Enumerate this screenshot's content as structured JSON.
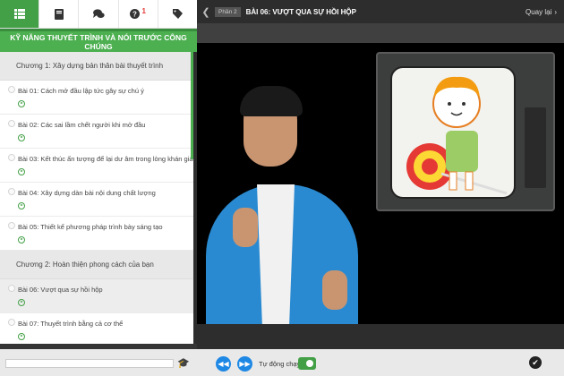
{
  "tabs": [
    {
      "icon": "list-icon",
      "active": true
    },
    {
      "icon": "book-icon",
      "active": false
    },
    {
      "icon": "chat-icon",
      "active": false
    },
    {
      "icon": "question-icon",
      "badge": "1",
      "active": false
    },
    {
      "icon": "tag-icon",
      "active": false
    }
  ],
  "course": {
    "title": "KỸ NĂNG THUYẾT TRÌNH VÀ NÓI TRƯỚC CÔNG CHÚNG"
  },
  "chapters": [
    {
      "title": "Chương 1: Xây dựng bản thân bài thuyết trình",
      "lessons": [
        "Bài 01: Cách mở đầu lập tức gây sự chú ý",
        "Bài 02: Các sai lầm chết người khi mở đầu",
        "Bài 03: Kết thúc ấn tượng để lại dư âm trong lòng khán giả",
        "Bài 04: Xây dựng dàn bài nội dung chất lượng",
        "Bài 05: Thiết kế phương pháp trình bày sáng tạo"
      ]
    },
    {
      "title": "Chương 2: Hoàn thiện phong cách của bạn",
      "lessons": [
        "Bài 06: Vượt qua sự hồi hộp",
        "Bài 07: Thuyết trình bằng cả cơ thể"
      ]
    }
  ],
  "header": {
    "part": "Phần 2",
    "lesson_title": "BÀI 06: VƯỢT QUA SỰ HỒI HỘP",
    "back_label": "Quay lại"
  },
  "player": {
    "autoplay_label": "Tự động chạy",
    "autoplay_on": true
  },
  "colors": {
    "accent": "#4caf50",
    "button": "#1e88e5"
  }
}
